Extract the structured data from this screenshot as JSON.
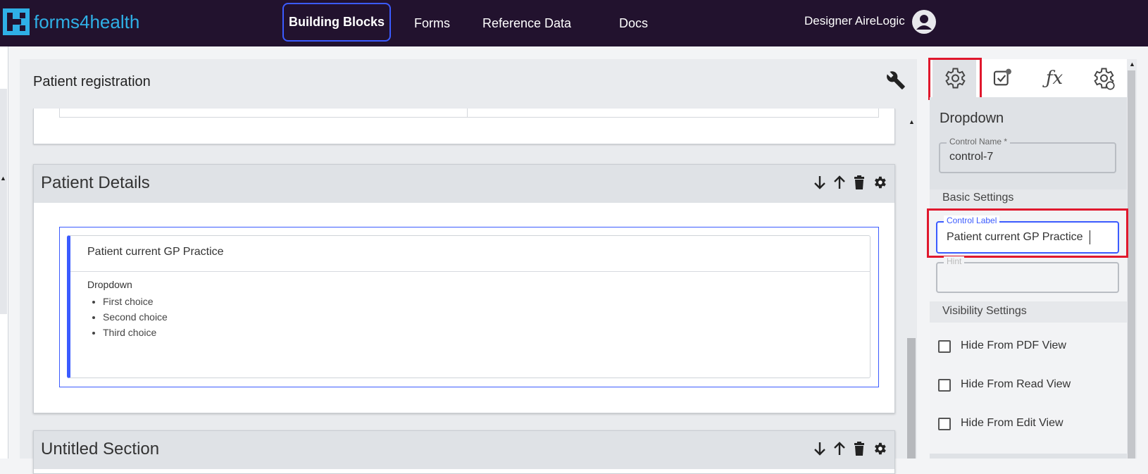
{
  "app": {
    "brand": "forms4health",
    "nav": [
      {
        "label": "Building Blocks",
        "active": true
      },
      {
        "label": "Forms"
      },
      {
        "label": "Reference Data"
      },
      {
        "label": "Docs"
      }
    ],
    "user": "Designer AireLogic"
  },
  "form": {
    "title": "Patient registration",
    "sections": [
      {
        "title": "Patient Details",
        "control": {
          "label": "Patient current GP Practice",
          "type": "Dropdown",
          "options": [
            "First choice",
            "Second choice",
            "Third choice"
          ]
        }
      },
      {
        "title": "Untitled Section"
      }
    ]
  },
  "panel": {
    "tabs": [
      "settings-icon",
      "validation-icon",
      "function-icon",
      "advanced-settings-icon"
    ],
    "title": "Dropdown",
    "control_name_legend": "Control Name *",
    "control_name_value": "control-7",
    "basic_settings": "Basic Settings",
    "control_label_legend": "Control Label",
    "control_label_value": "Patient current GP Practice",
    "hint_legend": "Hint",
    "hint_value": "",
    "visibility_settings": "Visibility Settings",
    "checkboxes": [
      "Hide From PDF View",
      "Hide From Read View",
      "Hide From Edit View"
    ]
  },
  "colors": {
    "topbar": "#22122e",
    "accent": "#3b5bff",
    "highlight": "#e0182d",
    "brand": "#2fb0e6"
  }
}
